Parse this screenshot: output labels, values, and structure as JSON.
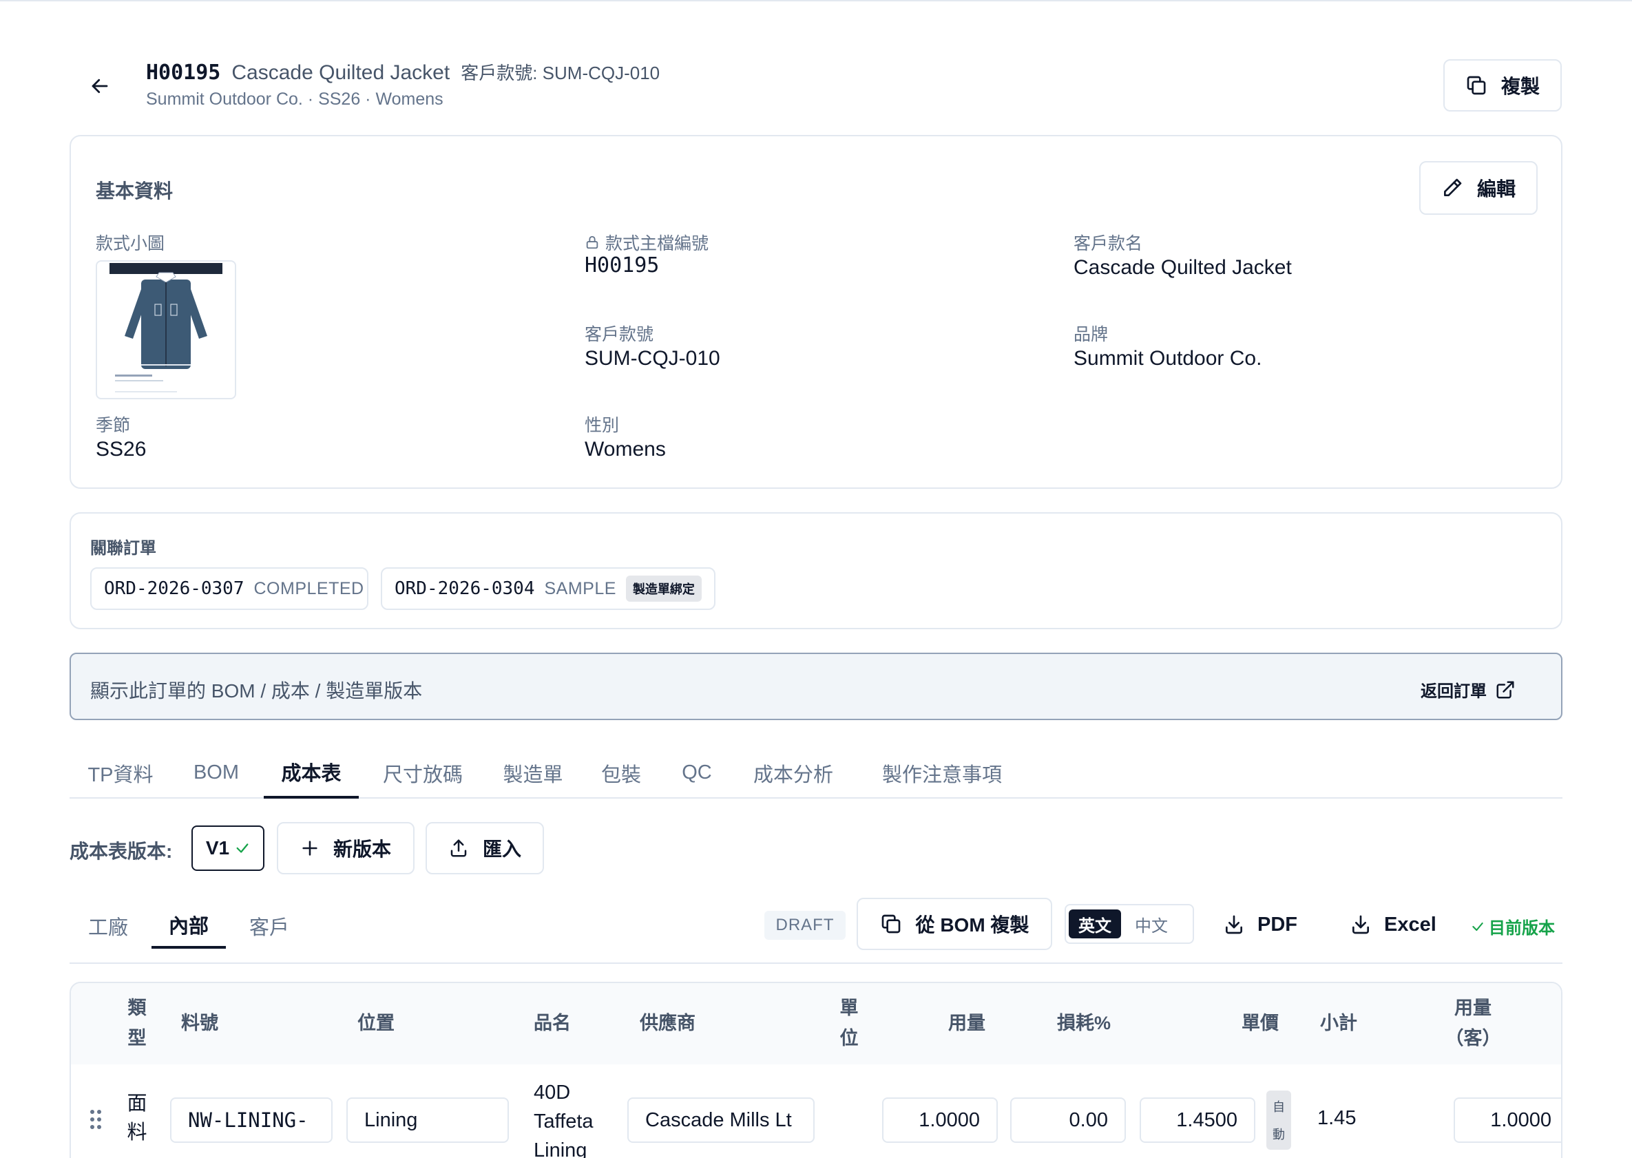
{
  "header": {
    "style_code": "H00195",
    "style_name": "Cascade Quilted Jacket",
    "customer_style_no": "客戶款號: SUM-CQJ-010",
    "subtitle": "Summit Outdoor Co. · SS26 · Womens",
    "copy_label": "複製"
  },
  "basic_info": {
    "title": "基本資料",
    "edit_label": "編輯",
    "thumb_label": "款式小圖",
    "master_no_label": "款式主檔編號",
    "master_no": "H00195",
    "customer_name_label": "客戶款名",
    "customer_name": "Cascade Quilted Jacket",
    "customer_no_label": "客戶款號",
    "customer_no": "SUM-CQJ-010",
    "brand_label": "品牌",
    "brand": "Summit Outdoor Co.",
    "season_label": "季節",
    "season": "SS26",
    "gender_label": "性別",
    "gender": "Womens",
    "thumb_header": "Cascade Quilted Jacket · SUM-CQJ-010",
    "thumb_caption": "PROTO — Front"
  },
  "linked_orders": {
    "title": "關聯訂單",
    "orders": [
      {
        "code": "ORD-2026-0307",
        "status": "COMPLETED"
      },
      {
        "code": "ORD-2026-0304",
        "status": "SAMPLE",
        "badge": "製造單綁定"
      }
    ]
  },
  "notice": {
    "text": "顯示此訂單的 BOM / 成本 / 製造單版本",
    "link": "返回訂單"
  },
  "tabs": [
    "TP資料",
    "BOM",
    "成本表",
    "尺寸放碼",
    "製造單",
    "包裝",
    "QC",
    "成本分析",
    "製作注意事項"
  ],
  "active_tab": "成本表",
  "version": {
    "label": "成本表版本:",
    "current": "V1",
    "new_label": "新版本",
    "import_label": "匯入"
  },
  "sub_tabs": [
    "工廠",
    "內部",
    "客戶"
  ],
  "active_sub_tab": "內部",
  "toolbar": {
    "status": "DRAFT",
    "from_bom": "從 BOM 複製",
    "lang_en": "英文",
    "lang_zh": "中文",
    "pdf": "PDF",
    "excel": "Excel",
    "current_version": "目前版本"
  },
  "table": {
    "headers": {
      "type": [
        "類",
        "型"
      ],
      "item_no": "料號",
      "position": "位置",
      "product": "品名",
      "supplier": "供應商",
      "unit": [
        "單",
        "位"
      ],
      "usage": "用量",
      "loss": "損耗%",
      "unit_price": "單價",
      "subtotal": "小計",
      "usage_customer": [
        "用量",
        "（客）"
      ]
    },
    "rows": [
      {
        "type": [
          "面",
          "料"
        ],
        "item_no": "NW-LINING-",
        "position": "Lining",
        "product": [
          "40D",
          "Taffeta",
          "Lining"
        ],
        "supplier": "Cascade Mills Lt",
        "usage": "1.0000",
        "loss": "0.00",
        "unit_price": "1.4500",
        "auto": [
          "自",
          "動"
        ],
        "subtotal": "1.45",
        "usage_customer": "1.0000"
      }
    ]
  }
}
